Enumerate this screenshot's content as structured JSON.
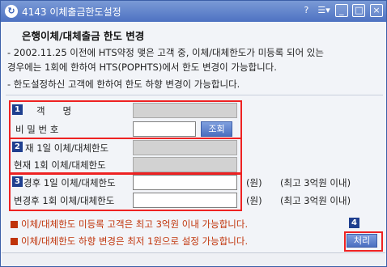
{
  "window": {
    "title": "4143 이체출금한도설정",
    "help_label": "?",
    "menu_label": "☰▾",
    "minimize_label": "_",
    "maximize_label": "□",
    "close_label": "×"
  },
  "heading": "은행이체/대체출금 한도 변경",
  "info": {
    "line1": "- 2002.11.25 이전에 HTS약정 맺은 고객 중, 이체/대체한도가 미등록 되어 있는",
    "line2": "경우에는 1회에 한하여 HTS(POPHTS)에서 한도 변경이 가능합니다.",
    "line3": "- 한도설정하신 고객에 한하여 한도 하향 변경이 가능합니다."
  },
  "section1": {
    "badge": "1",
    "name_label": "객      명",
    "name_value": "",
    "password_label": "비 밀 번 호",
    "password_value": "",
    "inquiry_button": "조회"
  },
  "section2": {
    "badge": "2",
    "current_daily_label": "재 1일 이체/대체한도",
    "current_daily_value": "",
    "current_once_label": "현재 1회 이체/대체한도",
    "current_once_value": ""
  },
  "section3": {
    "badge": "3",
    "new_daily_label": "경후 1일 이체/대체한도",
    "new_daily_value": "",
    "new_once_label": "변경후 1회 이체/대체한도",
    "new_once_value": "",
    "unit": "(원)",
    "max_note": "(최고 3억원 이내)"
  },
  "notices": {
    "notice1": "이체/대체한도 미등록 고객은 최고 3억원 이내 가능합니다.",
    "notice2": "이체/대체한도 하향 변경은 최저 1원으로 설정 가능합니다."
  },
  "submit": {
    "badge": "4",
    "label": "처리"
  }
}
